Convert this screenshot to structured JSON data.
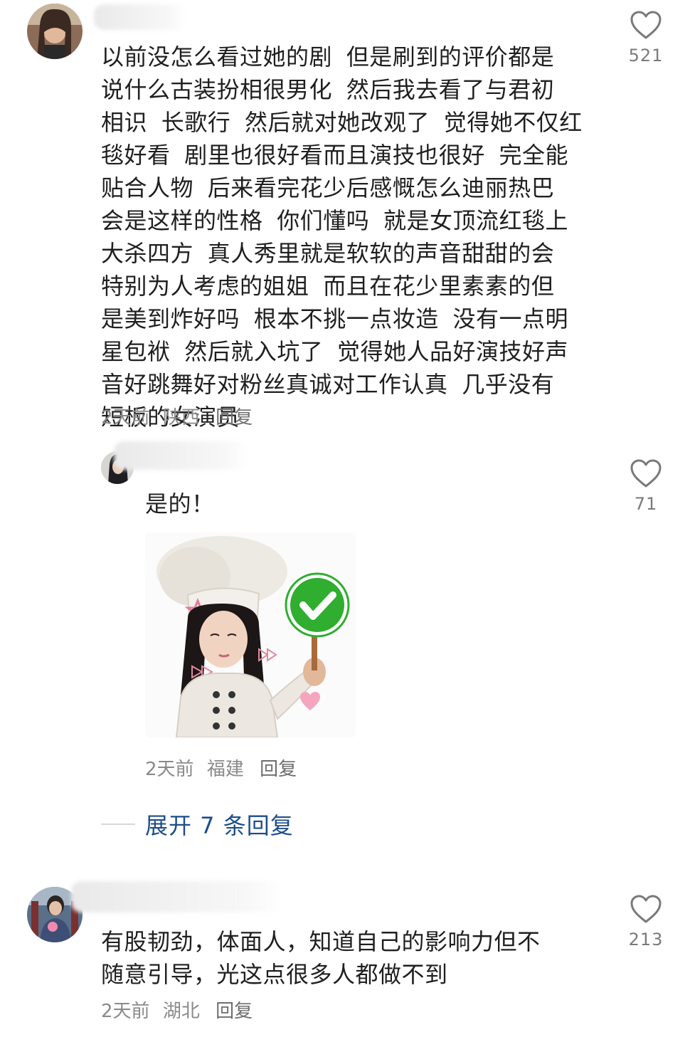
{
  "comments": [
    {
      "text": "以前没怎么看过她的剧 但是刷到的评价都是\n说什么古装扮相很男化 然后我去看了与君初\n相识 长歌行 然后就对她改观了 觉得她不仅红\n毯好看 剧里也很好看而且演技也很好 完全能\n贴合人物 后来看完花少后感慨怎么迪丽热巴\n会是这样的性格 你们懂吗 就是女顶流红毯上\n大杀四方 真人秀里就是软软的声音甜甜的会\n特别为人考虑的姐姐 而且在花少里素素的但\n是美到炸好吗 根本不挑一点妆造 没有一点明\n星包袱 然后就入坑了 觉得她人品好演技好声\n音好跳舞好对粉丝真诚对工作认真 几乎没有\n短板的女演员",
      "time": "2天前",
      "location": "陕西",
      "reply_label": "回复",
      "likes": "521",
      "like_icon": "heart-outline-icon"
    },
    {
      "text": "是的！",
      "time": "2天前",
      "location": "福建",
      "reply_label": "回复",
      "likes": "71",
      "like_icon": "heart-outline-icon",
      "sticker": "chef-girl-checkmark-sticker"
    },
    {
      "text": "有股韧劲，体面人，知道自己的影响力但不\n随意引导，光这点很多人都做不到",
      "time": "2天前",
      "location": "湖北",
      "reply_label": "回复",
      "likes": "213",
      "like_icon": "heart-outline-icon"
    }
  ],
  "expand_replies": {
    "label": "展开 7 条回复"
  },
  "colors": {
    "link": "#1d4e8a",
    "meta": "#8a8a8a",
    "text": "#1f1f1f",
    "check_green": "#2fae2f"
  }
}
